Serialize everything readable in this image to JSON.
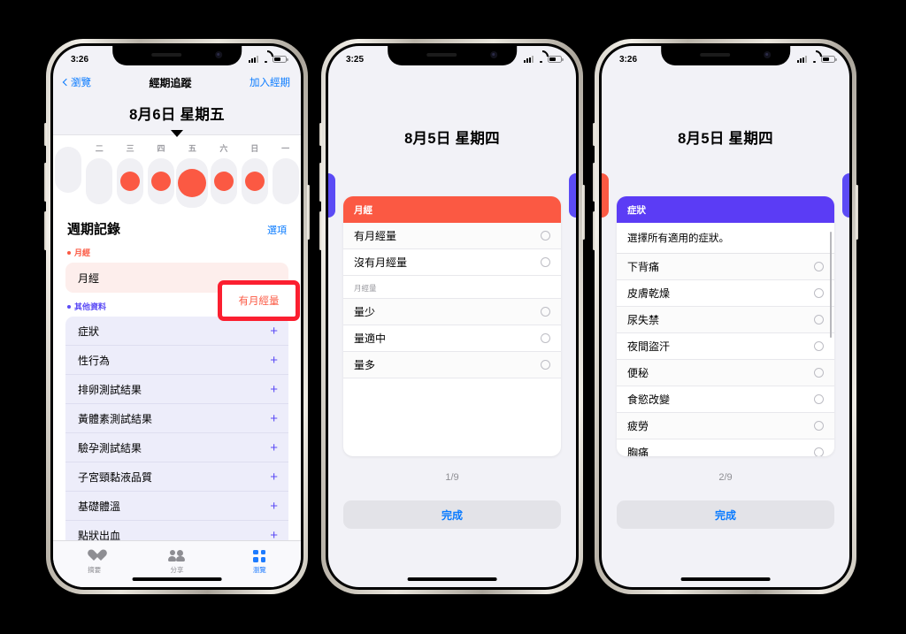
{
  "phone1": {
    "status": {
      "time": "3:26"
    },
    "nav": {
      "back_label": "瀏覽",
      "title": "經期追蹤",
      "action_label": "加入經期"
    },
    "date_title": "8月6日 星期五",
    "calendar": {
      "days": [
        {
          "dow": "",
          "has_flow": false,
          "selected": false
        },
        {
          "dow": "二",
          "has_flow": false,
          "selected": false
        },
        {
          "dow": "三",
          "has_flow": true,
          "selected": false
        },
        {
          "dow": "四",
          "has_flow": true,
          "selected": false
        },
        {
          "dow": "五",
          "has_flow": true,
          "selected": true
        },
        {
          "dow": "六",
          "has_flow": true,
          "selected": false
        },
        {
          "dow": "日",
          "has_flow": true,
          "selected": false
        },
        {
          "dow": "一",
          "has_flow": false,
          "selected": false
        }
      ]
    },
    "section": {
      "title": "週期記錄",
      "options_link": "選項",
      "group_period_label": "月經",
      "period_row_label": "月經",
      "group_other_label": "其他資料",
      "other_items": [
        {
          "label": "症狀",
          "add": "+"
        },
        {
          "label": "性行為",
          "add": "+"
        },
        {
          "label": "排卵測試結果",
          "add": "+"
        },
        {
          "label": "黃體素測試結果",
          "add": "+"
        },
        {
          "label": "驗孕測試結果",
          "add": "+"
        },
        {
          "label": "子宮頸黏液品質",
          "add": "+"
        },
        {
          "label": "基礎體溫",
          "add": "+"
        },
        {
          "label": "點狀出血",
          "add": "+"
        }
      ]
    },
    "annotation": {
      "label": "有月經量"
    },
    "tabbar": [
      {
        "label": "摘要",
        "icon": "heart-icon",
        "active": false
      },
      {
        "label": "分享",
        "icon": "people-icon",
        "active": false
      },
      {
        "label": "瀏覽",
        "icon": "grid-icon",
        "active": true
      }
    ]
  },
  "phone2": {
    "status": {
      "time": "3:25"
    },
    "date_title": "8月5日 星期四",
    "card": {
      "header": "月經",
      "header_color": "#fb5943",
      "rows": [
        {
          "label": "有月經量",
          "type": "radio"
        },
        {
          "label": "沒有月經量",
          "type": "radio"
        }
      ],
      "sublabel": "月經量",
      "flow_rows": [
        {
          "label": "量少",
          "type": "radio"
        },
        {
          "label": "量適中",
          "type": "radio"
        },
        {
          "label": "量多",
          "type": "radio"
        }
      ]
    },
    "pager": "1/9",
    "done_label": "完成",
    "peek_left_color": "#5b4bf5",
    "peek_right_color": "#5b4bf5"
  },
  "phone3": {
    "status": {
      "time": "3:26"
    },
    "date_title": "8月5日 星期四",
    "card": {
      "header": "症狀",
      "header_color": "#5b3cf5",
      "note": "選擇所有適用的症狀。",
      "rows": [
        {
          "label": "下背痛",
          "type": "radio"
        },
        {
          "label": "皮膚乾燥",
          "type": "radio"
        },
        {
          "label": "尿失禁",
          "type": "radio"
        },
        {
          "label": "夜間盜汗",
          "type": "radio"
        },
        {
          "label": "便秘",
          "type": "radio"
        },
        {
          "label": "食慾改變",
          "type": "radio"
        },
        {
          "label": "疲勞",
          "type": "radio"
        },
        {
          "label": "胸痛",
          "type": "radio"
        }
      ]
    },
    "pager": "2/9",
    "done_label": "完成",
    "peek_left_color": "#fb5943",
    "peek_right_color": "#5b4bf5"
  }
}
